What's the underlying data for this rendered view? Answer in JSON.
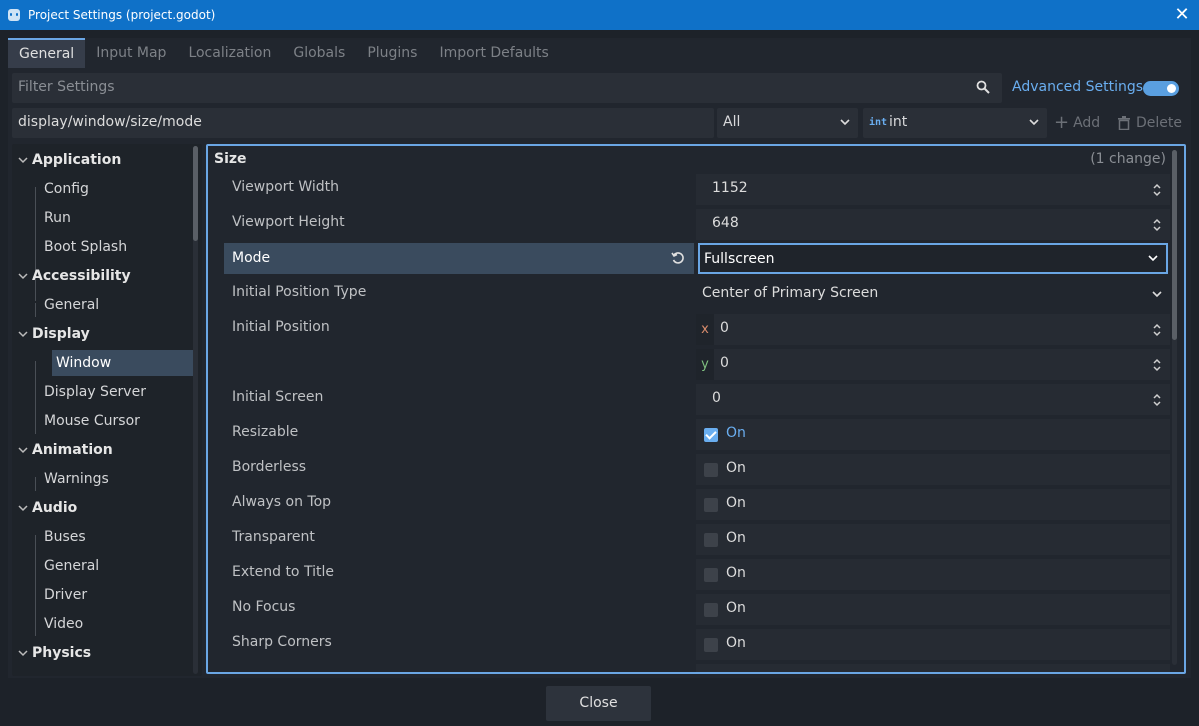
{
  "titlebar": {
    "title": "Project Settings (project.godot)"
  },
  "tabs": [
    "General",
    "Input Map",
    "Localization",
    "Globals",
    "Plugins",
    "Import Defaults"
  ],
  "filter": {
    "placeholder": "Filter Settings",
    "advanced_label": "Advanced Settings",
    "advanced_enabled": true
  },
  "path_row": {
    "path": "display/window/size/mode",
    "scope": "All",
    "type_icon": "int",
    "type": "int",
    "add_label": "Add",
    "delete_label": "Delete"
  },
  "tree": {
    "categories": [
      {
        "label": "Application",
        "items": [
          "Config",
          "Run",
          "Boot Splash"
        ]
      },
      {
        "label": "Accessibility",
        "items": [
          "General"
        ]
      },
      {
        "label": "Display",
        "items": [
          "Window",
          "Display Server",
          "Mouse Cursor"
        ]
      },
      {
        "label": "Animation",
        "items": [
          "Warnings"
        ]
      },
      {
        "label": "Audio",
        "items": [
          "Buses",
          "General",
          "Driver",
          "Video"
        ]
      },
      {
        "label": "Physics",
        "items": []
      }
    ],
    "selected": "Window"
  },
  "section": {
    "name": "Size",
    "changes": "(1 change)"
  },
  "properties": {
    "viewport_width": {
      "label": "Viewport Width",
      "value": "1152"
    },
    "viewport_height": {
      "label": "Viewport Height",
      "value": "648"
    },
    "mode": {
      "label": "Mode",
      "value": "Fullscreen"
    },
    "initial_position_type": {
      "label": "Initial Position Type",
      "value": "Center of Primary Screen"
    },
    "initial_position": {
      "label": "Initial Position",
      "x_axis": "x",
      "x": "0",
      "y_axis": "y",
      "y": "0"
    },
    "initial_screen": {
      "label": "Initial Screen",
      "value": "0"
    },
    "resizable": {
      "label": "Resizable",
      "value": "On",
      "checked": true
    },
    "borderless": {
      "label": "Borderless",
      "value": "On",
      "checked": false
    },
    "always_on_top": {
      "label": "Always on Top",
      "value": "On",
      "checked": false
    },
    "transparent": {
      "label": "Transparent",
      "value": "On",
      "checked": false
    },
    "extend_to_title": {
      "label": "Extend to Title",
      "value": "On",
      "checked": false
    },
    "no_focus": {
      "label": "No Focus",
      "value": "On",
      "checked": false
    },
    "sharp_corners": {
      "label": "Sharp Corners",
      "value": "On",
      "checked": false
    }
  },
  "footer": {
    "close_label": "Close"
  },
  "colors": {
    "accent": "#6aa6e4",
    "titlebar": "#0f71c8",
    "selected_row": "#3a4b5e"
  }
}
